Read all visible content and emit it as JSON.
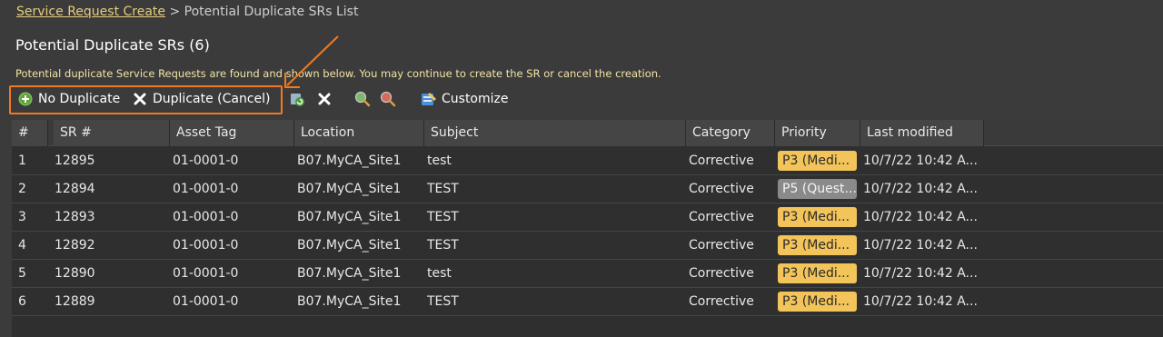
{
  "breadcrumb": {
    "link_label": "Service Request Create",
    "separator": ">",
    "current": "Potential Duplicate SRs List"
  },
  "page": {
    "title": "Potential Duplicate SRs (6)",
    "notice": "Potential duplicate Service Requests are found and shown below. You may continue to create the SR or cancel the creation."
  },
  "toolbar": {
    "no_duplicate_label": "No Duplicate",
    "duplicate_cancel_label": "Duplicate (Cancel)",
    "customize_label": "Customize"
  },
  "colors": {
    "accent_highlight": "#f07a22",
    "link": "#e6cc7a",
    "priority_p3": "#f2c45a",
    "priority_p5": "#8a8a8a"
  },
  "table": {
    "headers": {
      "num": "#",
      "sr": "SR #",
      "asset": "Asset Tag",
      "location": "Location",
      "subject": "Subject",
      "category": "Category",
      "priority": "Priority",
      "modified": "Last modified"
    },
    "rows": [
      {
        "num": "1",
        "sr": "12895",
        "asset": "01-0001-0",
        "location": "B07.MyCA_Site1",
        "subject": "test",
        "category": "Corrective",
        "priority": "P3 (Medi...",
        "priority_level": "p3",
        "modified": "10/7/22 10:42 A..."
      },
      {
        "num": "2",
        "sr": "12894",
        "asset": "01-0001-0",
        "location": "B07.MyCA_Site1",
        "subject": "TEST",
        "category": "Corrective",
        "priority": "P5 (Quest...",
        "priority_level": "p5",
        "modified": "10/7/22 10:42 A..."
      },
      {
        "num": "3",
        "sr": "12893",
        "asset": "01-0001-0",
        "location": "B07.MyCA_Site1",
        "subject": "TEST",
        "category": "Corrective",
        "priority": "P3 (Medi...",
        "priority_level": "p3",
        "modified": "10/7/22 10:42 A..."
      },
      {
        "num": "4",
        "sr": "12892",
        "asset": "01-0001-0",
        "location": "B07.MyCA_Site1",
        "subject": "TEST",
        "category": "Corrective",
        "priority": "P3 (Medi...",
        "priority_level": "p3",
        "modified": "10/7/22 10:42 A..."
      },
      {
        "num": "5",
        "sr": "12890",
        "asset": "01-0001-0",
        "location": "B07.MyCA_Site1",
        "subject": "test",
        "category": "Corrective",
        "priority": "P3 (Medi...",
        "priority_level": "p3",
        "modified": "10/7/22 10:42 A..."
      },
      {
        "num": "6",
        "sr": "12889",
        "asset": "01-0001-0",
        "location": "B07.MyCA_Site1",
        "subject": "TEST",
        "category": "Corrective",
        "priority": "P3 (Medi...",
        "priority_level": "p3",
        "modified": "10/7/22 10:42 A..."
      }
    ]
  }
}
